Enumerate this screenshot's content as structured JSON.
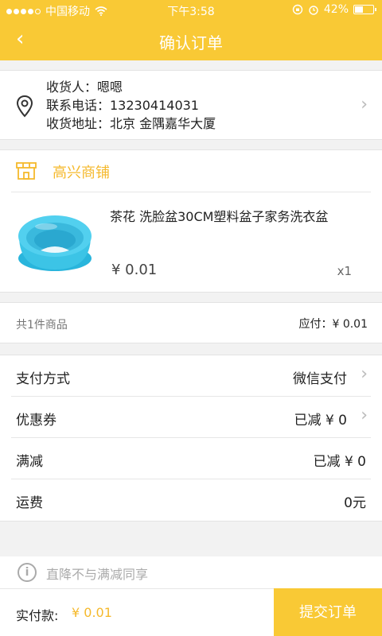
{
  "status_bar": {
    "carrier": "中国移动",
    "time": "下午3:58",
    "battery": "42%"
  },
  "nav": {
    "back": "‹",
    "title": "确认订单"
  },
  "address": {
    "receiver": "收货人：嗯嗯",
    "phone": "联系电话：13230414031",
    "location": "收货地址：北京 金隅嘉华大厦",
    "arrow": "›"
  },
  "shop": {
    "name": "高兴商铺"
  },
  "product": {
    "title": "茶花 洗脸盆30CM塑料盆子家务洗衣盆",
    "price": "¥ 0.01",
    "qty": "x1"
  },
  "summary": {
    "count": "共1件商品",
    "due": "应付：¥ 0.01"
  },
  "options": {
    "payment": {
      "label": "支付方式",
      "value": "微信支付",
      "arrow": "›"
    },
    "coupon": {
      "label": "优惠券",
      "value": "已减 ¥ 0",
      "arrow": "›"
    },
    "discount": {
      "label": "满减",
      "value": "已减 ¥ 0"
    },
    "shipping": {
      "label": "运费",
      "value": "0元"
    }
  },
  "notice": {
    "icon": "i",
    "text": "直降不与满减同享"
  },
  "bottom": {
    "pay_label": "实付款:",
    "pay_amount": "¥ 0.01",
    "submit": "提交订单"
  },
  "colors": {
    "accent": "#f9c935",
    "accent_text": "#f5b92c",
    "product_blue": "#3cc4e6"
  }
}
